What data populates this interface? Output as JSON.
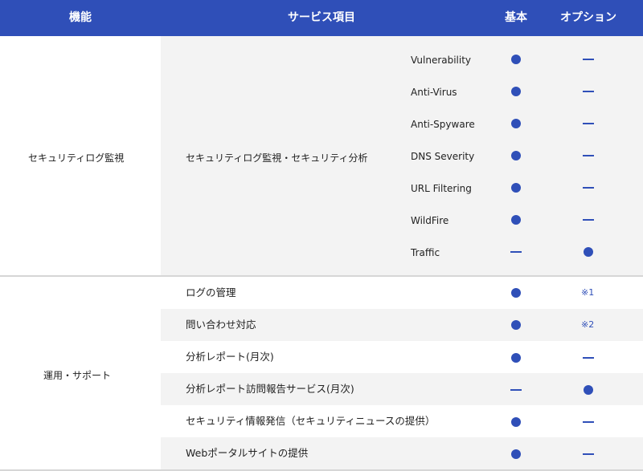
{
  "header": {
    "function": "機能",
    "service_item": "サービス項目",
    "basic": "基本",
    "option": "オプション"
  },
  "security": {
    "function": "セキュリティログ監視",
    "service": "セキュリティログ監視・セキュリティ分析",
    "items": [
      {
        "label": "Vulnerability",
        "basic": "circle",
        "option": "dash"
      },
      {
        "label": "Anti-Virus",
        "basic": "circle",
        "option": "dash"
      },
      {
        "label": "Anti-Spyware",
        "basic": "circle",
        "option": "dash"
      },
      {
        "label": "DNS Severity",
        "basic": "circle",
        "option": "dash"
      },
      {
        "label": "URL Filtering",
        "basic": "circle",
        "option": "dash"
      },
      {
        "label": "WildFire",
        "basic": "circle",
        "option": "dash"
      },
      {
        "label": "Traffic",
        "basic": "dash",
        "option": "circle"
      }
    ]
  },
  "operations": {
    "function": "運用・サポート",
    "items": [
      {
        "label": "ログの管理",
        "basic": "circle",
        "option": "note",
        "note": "※1"
      },
      {
        "label": "問い合わせ対応",
        "basic": "circle",
        "option": "note",
        "note": "※2"
      },
      {
        "label": "分析レポート(月次)",
        "basic": "circle",
        "option": "dash"
      },
      {
        "label": "分析レポート訪問報告サービス(月次)",
        "basic": "dash",
        "option": "circle"
      },
      {
        "label": "セキュリティ情報発信（セキュリティニュースの提供）",
        "basic": "circle",
        "option": "dash"
      },
      {
        "label": "Webポータルサイトの提供",
        "basic": "circle",
        "option": "dash"
      }
    ]
  },
  "colors": {
    "accent": "#2f4fb8",
    "header_bg": "#2f4fb8",
    "shade": "#f3f3f3",
    "divider": "#d6d6d6"
  }
}
